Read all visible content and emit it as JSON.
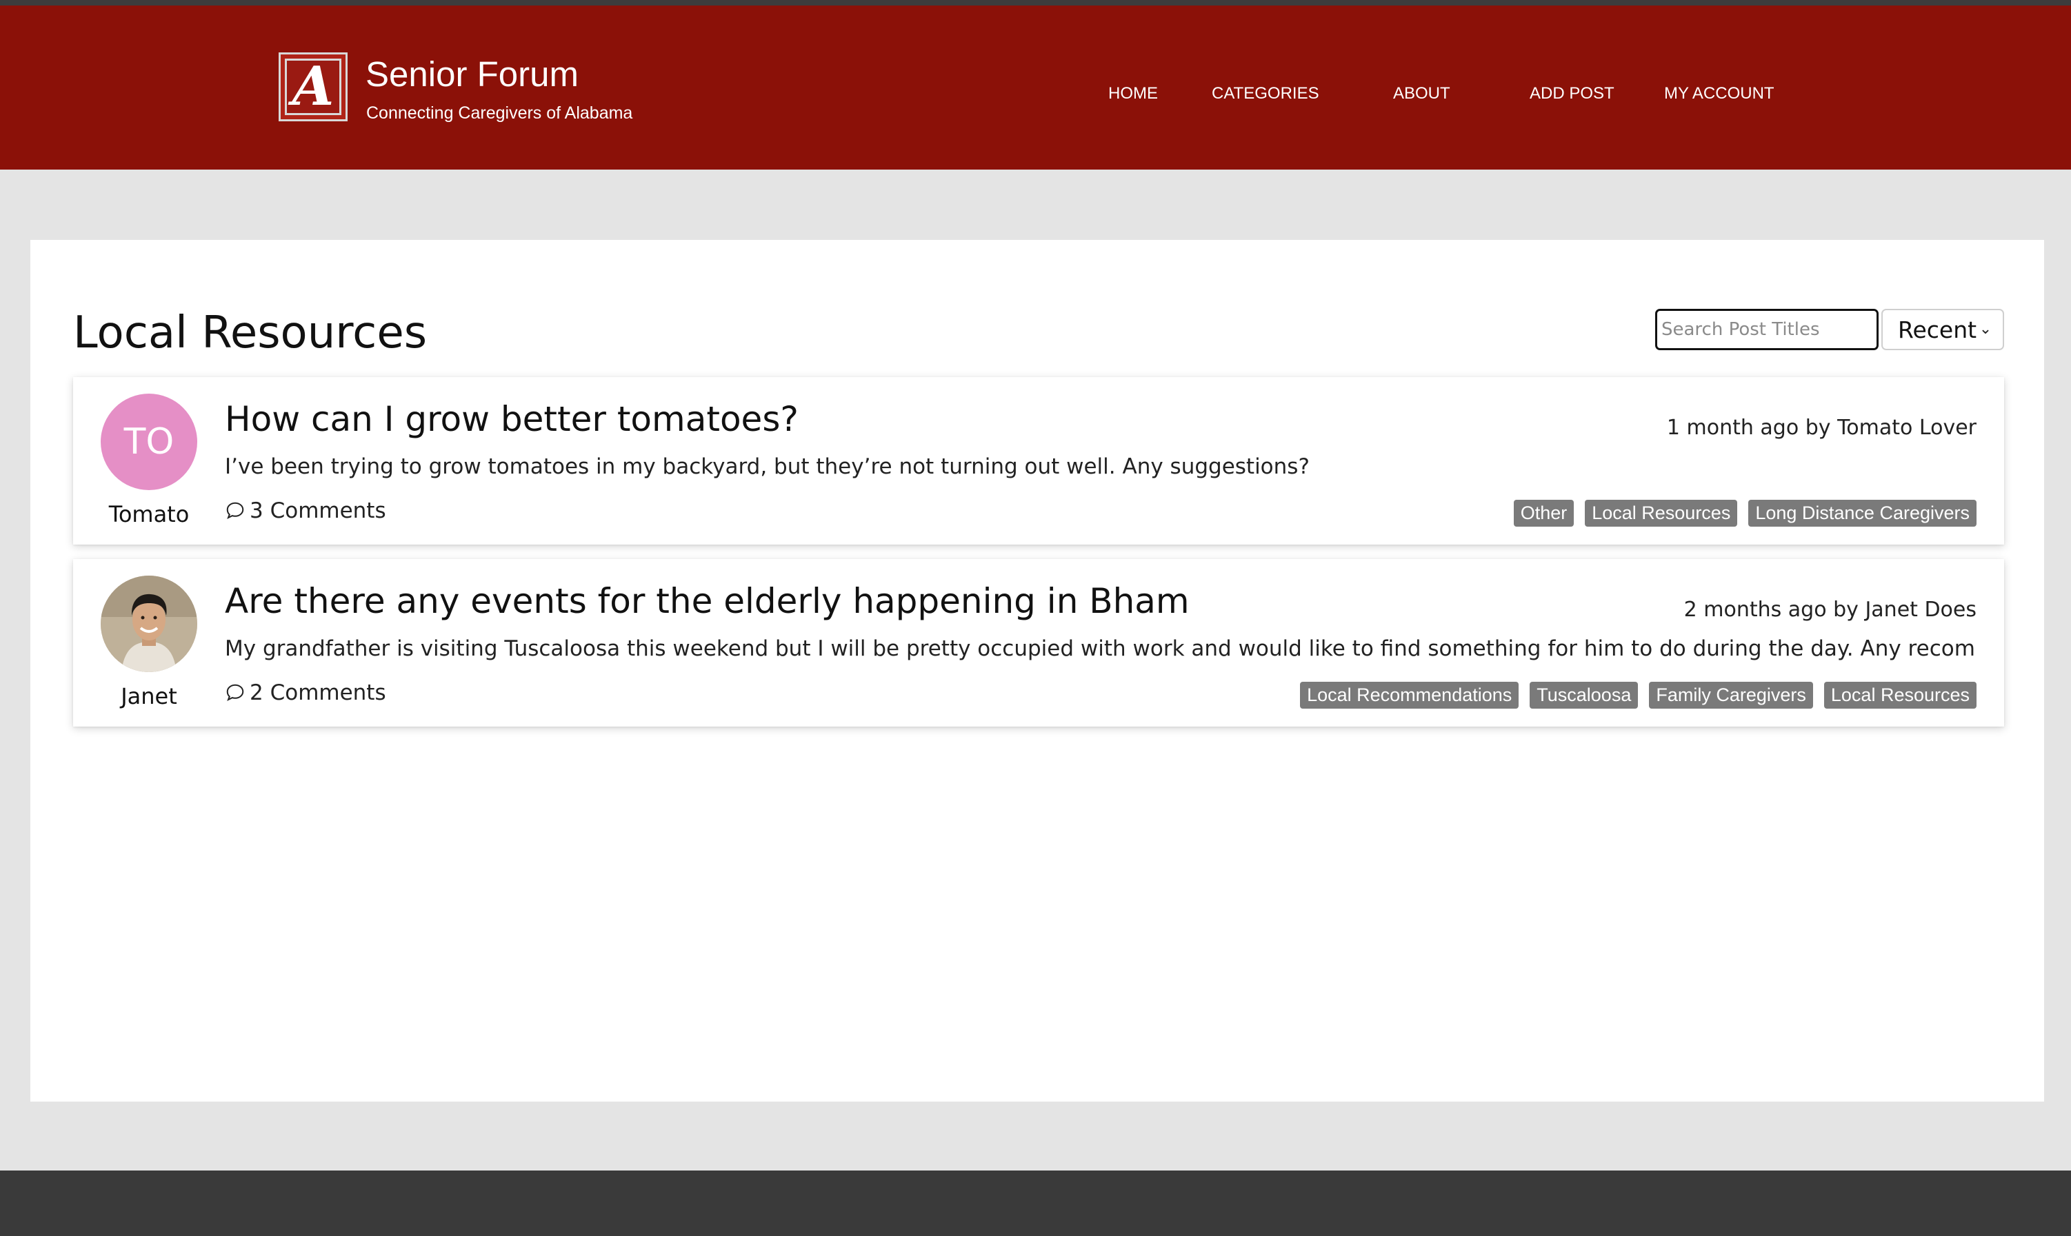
{
  "header": {
    "logo_letter": "A",
    "site_title": "Senior Forum",
    "site_subtitle": "Connecting Caregivers of Alabama",
    "nav": [
      {
        "label": "HOME"
      },
      {
        "label": "CATEGORIES"
      },
      {
        "label": "ABOUT"
      },
      {
        "label": "ADD POST"
      },
      {
        "label": "MY ACCOUNT"
      }
    ]
  },
  "main": {
    "page_title": "Local Resources",
    "search": {
      "placeholder": "Search Post Titles",
      "value": ""
    },
    "sort": {
      "selected": "Recent"
    },
    "posts": [
      {
        "avatar_initials": "TO",
        "avatar_color": "#e58fc6",
        "author_short": "Tomato",
        "title": "How can I grow better tomatoes?",
        "meta": "1 month ago by Tomato Lover",
        "excerpt": "I’ve been trying to grow tomatoes in my backyard, but they’re not turning out well. Any suggestions?",
        "comments": "3 Comments",
        "tags": [
          "Other",
          "Local Resources",
          "Long Distance Caregivers"
        ]
      },
      {
        "avatar_initials": "",
        "author_short": "Janet",
        "title": "Are there any events for the elderly happening in Bham",
        "meta": "2 months ago by Janet Does",
        "excerpt": "My grandfather is visiting Tuscaloosa this weekend but I will be pretty occupied with work and would like to find something for him to do during the day. Any recommendations···",
        "comments": "2 Comments",
        "tags": [
          "Local Recommendations",
          "Tuscaloosa",
          "Family Caregivers",
          "Local Resources"
        ]
      }
    ]
  },
  "colors": {
    "header_bg": "#8b1108",
    "page_bg": "#e4e4e4",
    "tag_bg": "#7a7a7a",
    "footer_bg": "#3a3a3a"
  }
}
